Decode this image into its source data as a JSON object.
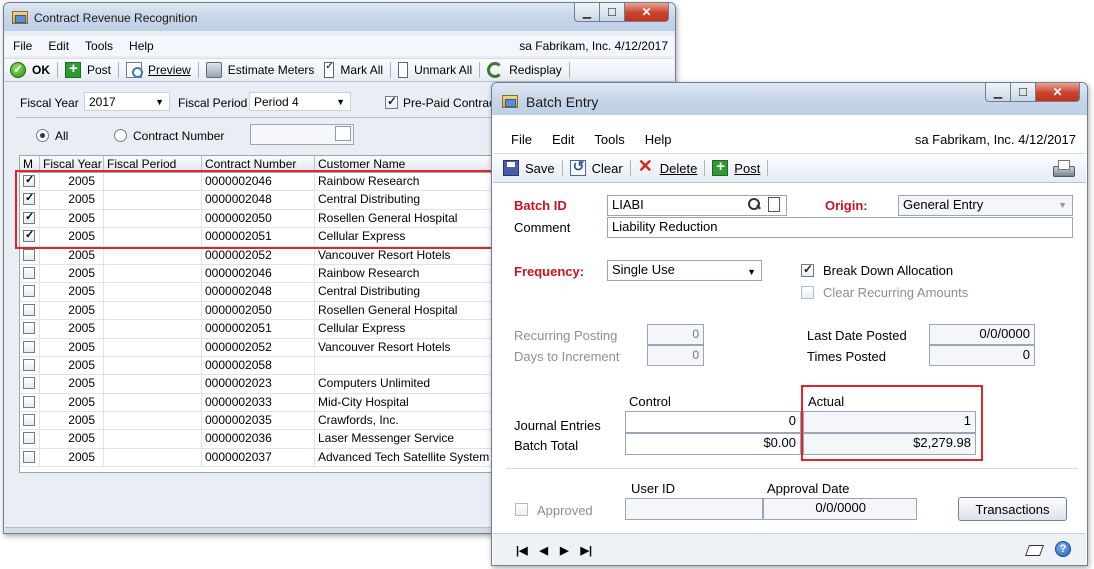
{
  "crr": {
    "title": "Contract Revenue Recognition",
    "menu": [
      "File",
      "Edit",
      "Tools",
      "Help"
    ],
    "user_info": "sa  Fabrikam, Inc. 4/12/2017",
    "toolbar": {
      "ok": "OK",
      "post": "Post",
      "preview": "Preview",
      "estimate_meters": "Estimate Meters",
      "mark_all": "Mark All",
      "unmark_all": "Unmark All",
      "redisplay": "Redisplay"
    },
    "filters": {
      "fiscal_year_label": "Fiscal Year",
      "fiscal_year_value": "2017",
      "fiscal_period_label": "Fiscal Period",
      "fiscal_period_value": "Period 4",
      "prepaid_label": "Pre-Paid Contracts",
      "all_label": "All",
      "contract_number_label": "Contract Number"
    },
    "grid": {
      "headers": [
        "M",
        "Fiscal Year",
        "Fiscal Period",
        "Contract Number",
        "Customer Name"
      ],
      "rows": [
        {
          "checked": true,
          "fy": "2005",
          "fp": "",
          "cn": "0000002046",
          "cust": "Rainbow Research"
        },
        {
          "checked": true,
          "fy": "2005",
          "fp": "",
          "cn": "0000002048",
          "cust": "Central Distributing"
        },
        {
          "checked": true,
          "fy": "2005",
          "fp": "",
          "cn": "0000002050",
          "cust": "Rosellen General Hospital"
        },
        {
          "checked": true,
          "fy": "2005",
          "fp": "",
          "cn": "0000002051",
          "cust": "Cellular Express"
        },
        {
          "checked": false,
          "fy": "2005",
          "fp": "",
          "cn": "0000002052",
          "cust": "Vancouver Resort Hotels"
        },
        {
          "checked": false,
          "fy": "2005",
          "fp": "",
          "cn": "0000002046",
          "cust": "Rainbow Research"
        },
        {
          "checked": false,
          "fy": "2005",
          "fp": "",
          "cn": "0000002048",
          "cust": "Central Distributing"
        },
        {
          "checked": false,
          "fy": "2005",
          "fp": "",
          "cn": "0000002050",
          "cust": "Rosellen General Hospital"
        },
        {
          "checked": false,
          "fy": "2005",
          "fp": "",
          "cn": "0000002051",
          "cust": "Cellular Express"
        },
        {
          "checked": false,
          "fy": "2005",
          "fp": "",
          "cn": "0000002052",
          "cust": "Vancouver Resort Hotels"
        },
        {
          "checked": false,
          "fy": "2005",
          "fp": "",
          "cn": "0000002058",
          "cust": ""
        },
        {
          "checked": false,
          "fy": "2005",
          "fp": "",
          "cn": "0000002023",
          "cust": "Computers Unlimited"
        },
        {
          "checked": false,
          "fy": "2005",
          "fp": "",
          "cn": "0000002033",
          "cust": "Mid-City Hospital"
        },
        {
          "checked": false,
          "fy": "2005",
          "fp": "",
          "cn": "0000002035",
          "cust": "Crawfords, Inc."
        },
        {
          "checked": false,
          "fy": "2005",
          "fp": "",
          "cn": "0000002036",
          "cust": "Laser Messenger Service"
        },
        {
          "checked": false,
          "fy": "2005",
          "fp": "",
          "cn": "0000002037",
          "cust": "Advanced Tech Satellite System"
        }
      ]
    }
  },
  "batch": {
    "title": "Batch Entry",
    "menu": [
      "File",
      "Edit",
      "Tools",
      "Help"
    ],
    "user_info": "sa  Fabrikam, Inc. 4/12/2017",
    "toolbar": {
      "save": "Save",
      "clear": "Clear",
      "delete": "Delete",
      "post": "Post"
    },
    "batch_id_label": "Batch ID",
    "batch_id_value": "LIABI",
    "origin_label": "Origin:",
    "origin_value": "General Entry",
    "comment_label": "Comment",
    "comment_value": "Liability Reduction",
    "frequency_label": "Frequency:",
    "frequency_value": "Single Use",
    "break_down_label": "Break Down Allocation",
    "clear_recurring_label": "Clear Recurring Amounts",
    "recurring_posting_label": "Recurring Posting",
    "recurring_posting_value": "0",
    "days_increment_label": "Days to Increment",
    "days_increment_value": "0",
    "last_date_label": "Last Date Posted",
    "last_date_value": "0/0/0000",
    "times_posted_label": "Times Posted",
    "times_posted_value": "0",
    "control_label": "Control",
    "actual_label": "Actual",
    "journal_entries_label": "Journal Entries",
    "journal_control": "0",
    "journal_actual": "1",
    "batch_total_label": "Batch Total",
    "batch_total_control": "$0.00",
    "batch_total_actual": "$2,279.98",
    "user_id_label": "User ID",
    "approval_date_label": "Approval Date",
    "approval_date_value": "0/0/0000",
    "approved_label": "Approved",
    "transactions_button": "Transactions"
  }
}
